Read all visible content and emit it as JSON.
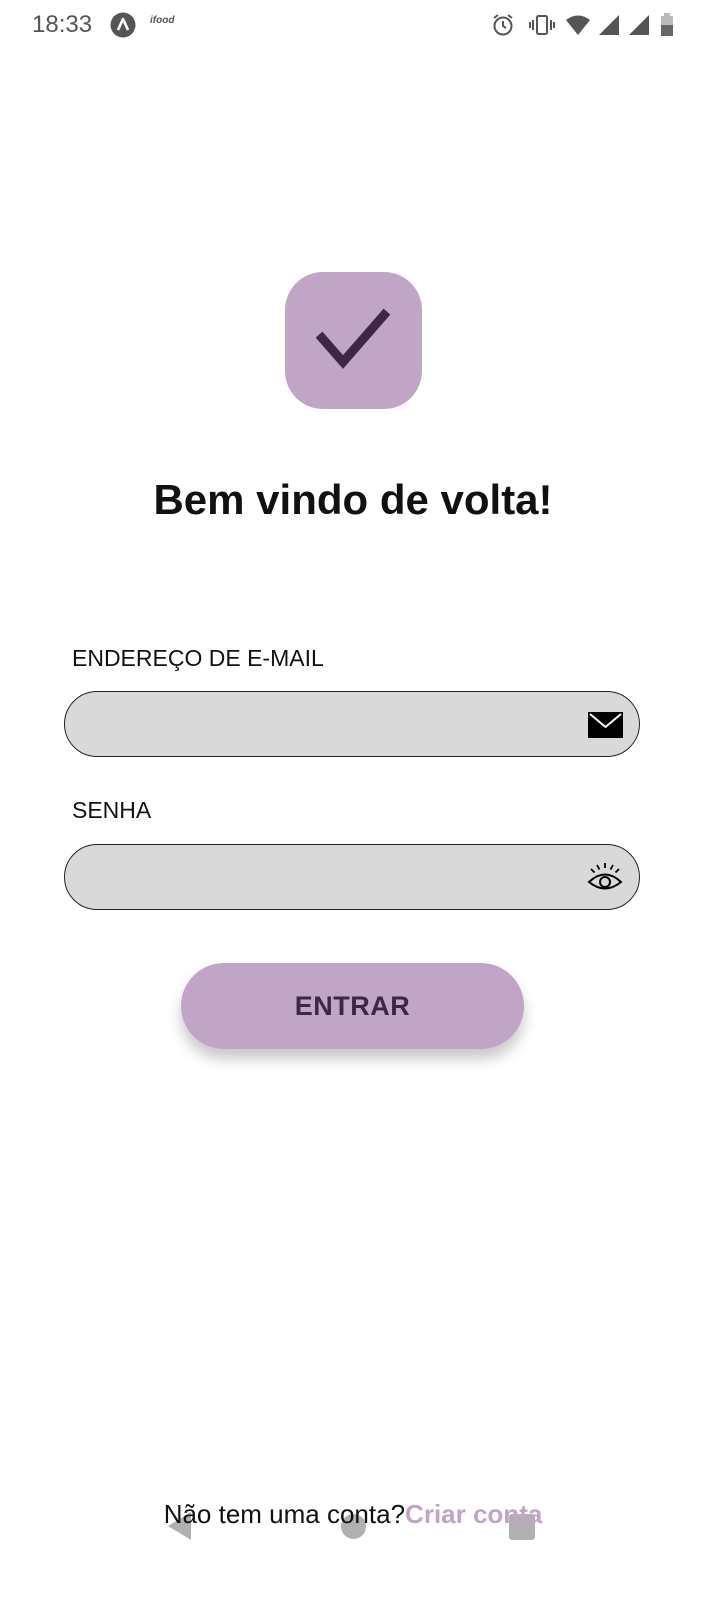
{
  "status_bar": {
    "time": "18:33",
    "ifood_label": "ifood",
    "icons": [
      "app-a-icon",
      "ifood-icon",
      "alarm-icon",
      "vibrate-icon",
      "wifi-icon",
      "signal-icon",
      "signal-icon",
      "battery-icon"
    ]
  },
  "logo": {
    "icon": "checkmark-icon",
    "background_color": "#c0a5c6",
    "check_color": "#3f2548"
  },
  "welcome": {
    "title": "Bem vindo de volta!"
  },
  "form": {
    "email_label": "ENDEREÇO DE E-MAIL",
    "email_value": "",
    "email_icon": "envelope-icon",
    "password_label": "SENHA",
    "password_value": "",
    "password_icon": "eye-icon",
    "submit_label": "ENTRAR"
  },
  "signup": {
    "prompt": "Não tem uma conta?",
    "link": "Criar conta"
  },
  "colors": {
    "accent": "#c0a5c6",
    "accent_dark": "#3f2548",
    "field_bg": "#d9d9d9"
  }
}
